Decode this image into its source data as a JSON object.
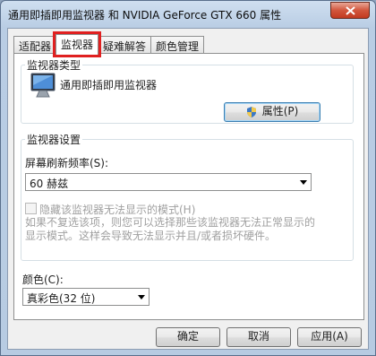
{
  "window": {
    "title": "通用即插即用监视器 和 NVIDIA GeForce GTX 660 属性"
  },
  "tabs": [
    {
      "label": "适配器"
    },
    {
      "label": "监视器"
    },
    {
      "label": "疑难解答"
    },
    {
      "label": "颜色管理"
    }
  ],
  "monitor_type": {
    "group_label": "监视器类型",
    "monitor_name": "通用即插即用监视器",
    "properties_button": "属性(P)"
  },
  "monitor_settings": {
    "group_label": "监视器设置",
    "refresh_label": "屏幕刷新频率(S):",
    "refresh_value": "60 赫兹",
    "hide_modes_label": "隐藏该监视器无法显示的模式(H)",
    "hide_modes_checked": false,
    "description": "如果不复选该项，则您可以选择那些该监视器无法正常显示的显示模式。这样会导致无法显示并且/或者损坏硬件。"
  },
  "color": {
    "label": "颜色(C):",
    "value": "真彩色(32 位)"
  },
  "footer": {
    "ok": "确定",
    "cancel": "取消",
    "apply": "应用(A)"
  }
}
